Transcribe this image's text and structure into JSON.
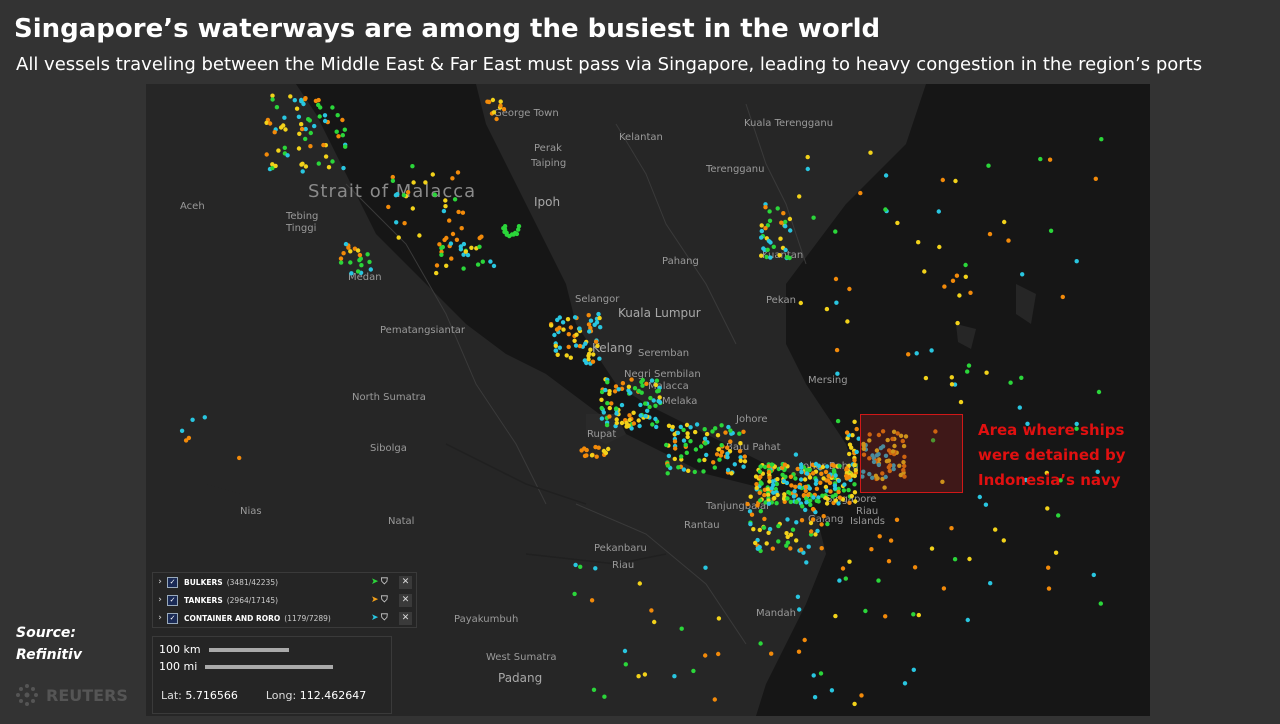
{
  "header": {
    "title": "Singapore’s waterways are among the busiest in the world",
    "subtitle": "All vessels traveling between the Middle East & Far East must pass via Singapore, leading to heavy congestion in the region’s ports"
  },
  "annotation": {
    "lines": [
      "Area where ships",
      "were detained by",
      "Indonesia’s navy"
    ],
    "color": "#e01010"
  },
  "source": {
    "label": "Source:",
    "value": "Refinitiv"
  },
  "branding": {
    "logo_text": "REUTERS"
  },
  "map": {
    "labels": {
      "strait": "Strait of Malacca",
      "george_town": "George Town",
      "perak": "Perak",
      "taiping": "Taiping",
      "kelantan": "Kelantan",
      "kuala_terengganu": "Kuala Terengganu",
      "terengganu": "Terengganu",
      "ipoh": "Ipoh",
      "aceh": "Aceh",
      "tebing_tinggi_1": "Tebing",
      "tebing_tinggi_2": "Tinggi",
      "medan": "Medan",
      "pahang": "Pahang",
      "kuantan": "Kuantan",
      "pekan": "Pekan",
      "selangor": "Selangor",
      "kuala_lumpur": "Kuala Lumpur",
      "pematangsiantar": "Pematangsiantar",
      "kelang": "Kelang",
      "seremban": "Seremban",
      "negri_sembilan": "Negri Sembilan",
      "malacca": "Malacca",
      "melaka": "Melaka",
      "mersing": "Mersing",
      "north_sumatra": "North Sumatra",
      "johore": "Johore",
      "rupat": "Rupat",
      "sibolga": "Sibolga",
      "batu_pahat": "Batu Pahat",
      "johor_bahru": "Johor Bahru",
      "singapore": "Singapore",
      "nias": "Nias",
      "natal": "Natal",
      "tanjungbalai": "Tanjungbalai",
      "rantau": "Rantau",
      "galang": "Galang",
      "riau_islands_1": "Riau",
      "riau_islands_2": "Islands",
      "pekanbaru": "Pekanbaru",
      "riau": "Riau",
      "mandah": "Mandah",
      "payakumbuh": "Payakumbuh",
      "west_sumatra": "West Sumatra",
      "padang": "Padang"
    },
    "vessel_colors": {
      "bulkers": "#2bd63a",
      "tankers": "#f28a0a",
      "tankers_alt": "#f2d21a",
      "container": "#29c6e0"
    }
  },
  "legend": {
    "rows": [
      {
        "label": "BULKERS",
        "count": "(3481/42235)",
        "checked": "✓"
      },
      {
        "label": "TANKERS",
        "count": "(2964/17145)",
        "checked": "✓"
      },
      {
        "label": "CONTAINER AND RORO",
        "count": "(1179/7289)",
        "checked": "✓"
      }
    ]
  },
  "scale": {
    "km": "100 km",
    "mi": "100 mi",
    "lat_label": "Lat:",
    "lat_value": "5.716566",
    "long_label": "Long:",
    "long_value": "112.462647"
  }
}
